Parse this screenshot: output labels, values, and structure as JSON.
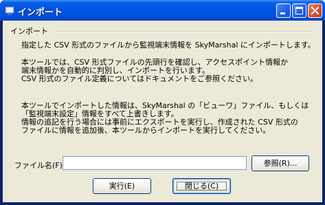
{
  "window": {
    "title": "インポート",
    "buttons": {
      "minimize": "minimize-icon",
      "maximize": "maximize-icon",
      "close": "close-icon"
    }
  },
  "group": {
    "label": "インポート"
  },
  "paragraphs": [
    [
      "指定した CSV 形式のファイルから監視端末情報を SkyMarshal にインポートします。"
    ],
    [
      "本ツールでは、CSV 形式ファイルの先頭行を確認し、アクセスポイント情報か",
      "端末情報かを自動的に判別し、インポートを行います。",
      "CSV 形式のファイル定義についてはドキュメントをご参照ください。"
    ],
    [
      "本ツールでインポートした情報は、SkyMarshal の「ビューワ」ファイル、もしくは",
      "「監視端末設定」情報をすべて上書きします。",
      "情報の追記を行う場合には事前にエクスポートを実行し、作成された CSV 形式の",
      "ファイルに情報を追加後、本ツールからインポートを実行してください。"
    ]
  ],
  "file": {
    "label": "ファイル名(F):",
    "value": "",
    "browse_label": "参照(R)..."
  },
  "actions": {
    "run_label": "実行(E)",
    "close_label": "閉じる(C)"
  },
  "colors": {
    "titlebar": "#0054e3",
    "client_bg": "#ece9d8",
    "close_button": "#d5502d"
  }
}
